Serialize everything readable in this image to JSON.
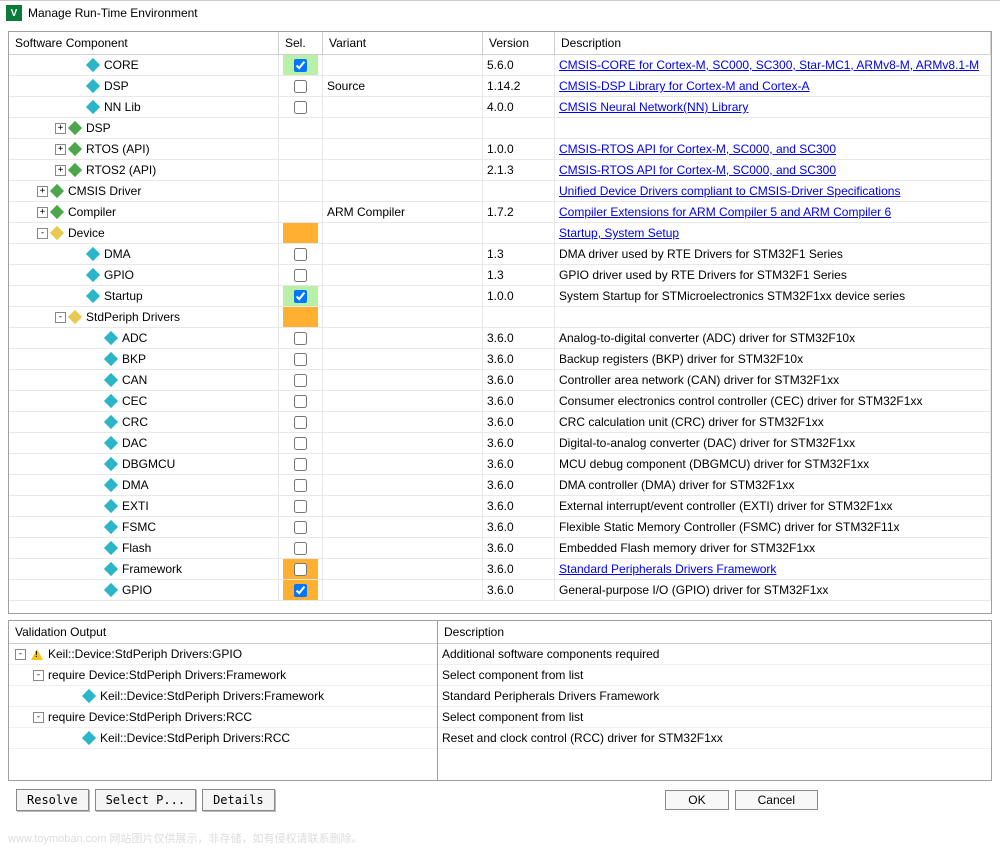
{
  "window": {
    "title": "Manage Run-Time Environment"
  },
  "headers": {
    "component": "Software Component",
    "sel": "Sel.",
    "variant": "Variant",
    "version": "Version",
    "description": "Description"
  },
  "rows": [
    {
      "indent": 3,
      "exp": "",
      "icon": "cyan",
      "name": "CORE",
      "sel": "checked-green",
      "variant": "",
      "version": "5.6.0",
      "desc": "CMSIS-CORE for Cortex-M, SC000, SC300, Star-MC1, ARMv8-M, ARMv8.1-M",
      "link": true
    },
    {
      "indent": 3,
      "exp": "",
      "icon": "cyan",
      "name": "DSP",
      "sel": "empty",
      "variant": "Source",
      "version": "1.14.2",
      "desc": "CMSIS-DSP Library for Cortex-M and Cortex-A",
      "link": true
    },
    {
      "indent": 3,
      "exp": "",
      "icon": "cyan",
      "name": "NN Lib",
      "sel": "empty",
      "variant": "",
      "version": "4.0.0",
      "desc": "CMSIS Neural Network(NN) Library",
      "link": true
    },
    {
      "indent": 2,
      "exp": "+",
      "icon": "green",
      "name": "DSP",
      "sel": "",
      "variant": "",
      "version": "",
      "desc": "",
      "link": false
    },
    {
      "indent": 2,
      "exp": "+",
      "icon": "green",
      "name": "RTOS (API)",
      "sel": "",
      "variant": "",
      "version": "1.0.0",
      "desc": "CMSIS-RTOS API for Cortex-M, SC000, and SC300",
      "link": true
    },
    {
      "indent": 2,
      "exp": "+",
      "icon": "green",
      "name": "RTOS2 (API)",
      "sel": "",
      "variant": "",
      "version": "2.1.3",
      "desc": "CMSIS-RTOS API for Cortex-M, SC000, and SC300",
      "link": true
    },
    {
      "indent": 1,
      "exp": "+",
      "icon": "green",
      "name": "CMSIS Driver",
      "sel": "",
      "variant": "",
      "version": "",
      "desc": "Unified Device Drivers compliant to CMSIS-Driver Specifications",
      "link": true
    },
    {
      "indent": 1,
      "exp": "+",
      "icon": "green",
      "name": "Compiler",
      "sel": "",
      "variant": "ARM Compiler",
      "version": "1.7.2",
      "desc": "Compiler Extensions for ARM Compiler 5 and ARM Compiler 6",
      "link": true
    },
    {
      "indent": 1,
      "exp": "-",
      "icon": "yellow",
      "name": "Device",
      "sel": "orange-none",
      "variant": "",
      "version": "",
      "desc": "Startup, System Setup",
      "link": true
    },
    {
      "indent": 3,
      "exp": "",
      "icon": "cyan",
      "name": "DMA",
      "sel": "empty",
      "variant": "",
      "version": "1.3",
      "desc": "DMA driver used by RTE Drivers for STM32F1 Series",
      "link": false
    },
    {
      "indent": 3,
      "exp": "",
      "icon": "cyan",
      "name": "GPIO",
      "sel": "empty",
      "variant": "",
      "version": "1.3",
      "desc": "GPIO driver used by RTE Drivers for STM32F1 Series",
      "link": false
    },
    {
      "indent": 3,
      "exp": "",
      "icon": "cyan",
      "name": "Startup",
      "sel": "checked-green",
      "variant": "",
      "version": "1.0.0",
      "desc": "System Startup for STMicroelectronics STM32F1xx device series",
      "link": false
    },
    {
      "indent": 2,
      "exp": "-",
      "icon": "yellow",
      "name": "StdPeriph Drivers",
      "sel": "orange-none",
      "variant": "",
      "version": "",
      "desc": "",
      "link": false
    },
    {
      "indent": 4,
      "exp": "",
      "icon": "cyan",
      "name": "ADC",
      "sel": "empty",
      "variant": "",
      "version": "3.6.0",
      "desc": "Analog-to-digital converter (ADC) driver for STM32F10x",
      "link": false
    },
    {
      "indent": 4,
      "exp": "",
      "icon": "cyan",
      "name": "BKP",
      "sel": "empty",
      "variant": "",
      "version": "3.6.0",
      "desc": "Backup registers (BKP) driver for STM32F10x",
      "link": false
    },
    {
      "indent": 4,
      "exp": "",
      "icon": "cyan",
      "name": "CAN",
      "sel": "empty",
      "variant": "",
      "version": "3.6.0",
      "desc": "Controller area network (CAN) driver for STM32F1xx",
      "link": false
    },
    {
      "indent": 4,
      "exp": "",
      "icon": "cyan",
      "name": "CEC",
      "sel": "empty",
      "variant": "",
      "version": "3.6.0",
      "desc": "Consumer electronics control controller (CEC) driver for STM32F1xx",
      "link": false
    },
    {
      "indent": 4,
      "exp": "",
      "icon": "cyan",
      "name": "CRC",
      "sel": "empty",
      "variant": "",
      "version": "3.6.0",
      "desc": "CRC calculation unit (CRC) driver for STM32F1xx",
      "link": false
    },
    {
      "indent": 4,
      "exp": "",
      "icon": "cyan",
      "name": "DAC",
      "sel": "empty",
      "variant": "",
      "version": "3.6.0",
      "desc": "Digital-to-analog converter (DAC) driver for STM32F1xx",
      "link": false
    },
    {
      "indent": 4,
      "exp": "",
      "icon": "cyan",
      "name": "DBGMCU",
      "sel": "empty",
      "variant": "",
      "version": "3.6.0",
      "desc": "MCU debug component (DBGMCU) driver for STM32F1xx",
      "link": false
    },
    {
      "indent": 4,
      "exp": "",
      "icon": "cyan",
      "name": "DMA",
      "sel": "empty",
      "variant": "",
      "version": "3.6.0",
      "desc": "DMA controller (DMA) driver for STM32F1xx",
      "link": false
    },
    {
      "indent": 4,
      "exp": "",
      "icon": "cyan",
      "name": "EXTI",
      "sel": "empty",
      "variant": "",
      "version": "3.6.0",
      "desc": "External interrupt/event controller (EXTI) driver for STM32F1xx",
      "link": false
    },
    {
      "indent": 4,
      "exp": "",
      "icon": "cyan",
      "name": "FSMC",
      "sel": "empty",
      "variant": "",
      "version": "3.6.0",
      "desc": "Flexible Static Memory Controller (FSMC) driver for STM32F11x",
      "link": false
    },
    {
      "indent": 4,
      "exp": "",
      "icon": "cyan",
      "name": "Flash",
      "sel": "empty",
      "variant": "",
      "version": "3.6.0",
      "desc": "Embedded Flash memory driver for STM32F1xx",
      "link": false
    },
    {
      "indent": 4,
      "exp": "",
      "icon": "cyan",
      "name": "Framework",
      "sel": "orange-empty",
      "variant": "",
      "version": "3.6.0",
      "desc": "Standard Peripherals Drivers Framework",
      "link": true
    },
    {
      "indent": 4,
      "exp": "",
      "icon": "cyan",
      "name": "GPIO",
      "sel": "checked-orange",
      "variant": "",
      "version": "3.6.0",
      "desc": "General-purpose I/O (GPIO) driver for STM32F1xx",
      "link": false
    }
  ],
  "validation": {
    "header": "Validation Output",
    "desc_header": "Description",
    "items": [
      {
        "indent": 0,
        "exp": "-",
        "warn": true,
        "text": "Keil::Device:StdPeriph Drivers:GPIO",
        "desc": "Additional software components required"
      },
      {
        "indent": 1,
        "exp": "-",
        "warn": false,
        "text": "require Device:StdPeriph Drivers:Framework",
        "desc": "Select component from list"
      },
      {
        "indent": 3,
        "exp": "",
        "warn": false,
        "icon": "cyan",
        "text": "Keil::Device:StdPeriph Drivers:Framework",
        "desc": "Standard Peripherals Drivers Framework"
      },
      {
        "indent": 1,
        "exp": "-",
        "warn": false,
        "text": "require Device:StdPeriph Drivers:RCC",
        "desc": "Select component from list"
      },
      {
        "indent": 3,
        "exp": "",
        "warn": false,
        "icon": "cyan",
        "text": "Keil::Device:StdPeriph Drivers:RCC",
        "desc": "Reset and clock control (RCC) driver for STM32F1xx"
      }
    ]
  },
  "buttons": {
    "resolve": "Resolve",
    "select": "Select P...",
    "details": "Details",
    "ok": "OK",
    "cancel": "Cancel"
  },
  "watermark": "www.toymoban.com 网站图片仅供展示，非存储，如有侵权请联系删除。"
}
